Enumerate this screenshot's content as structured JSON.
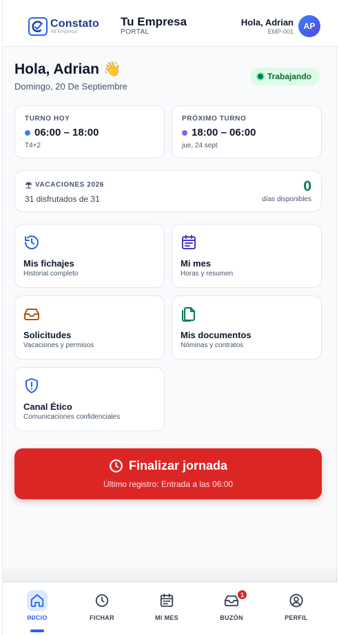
{
  "header": {
    "logo_text": "Constato",
    "logo_sub": "Mi Empresa",
    "company": "Tu Empresa",
    "portal": "PORTAL",
    "greeting": "Hola, Adrian",
    "employee_id": "EMP-001",
    "avatar_initials": "AP"
  },
  "greeting": {
    "title": "Hola, Adrian 👋",
    "date": "Domingo, 20 De Septiembre",
    "status": "Trabajando"
  },
  "shift_today": {
    "label": "TURNO HOY",
    "time": "06:00 – 18:00",
    "sub": "T4+2",
    "dot_color": "#3b82f6"
  },
  "shift_next": {
    "label": "PRÓXIMO TURNO",
    "time": "18:00 – 06:00",
    "sub": "jue, 24 sept",
    "dot_color": "#8b5cf6"
  },
  "vacations": {
    "label": "VACACIONES 2026",
    "used": "31 disfrutados de 31",
    "available_count": "0",
    "available_label": "días disponibles"
  },
  "tiles": [
    {
      "title": "Mis fichajes",
      "sub": "Historial completo",
      "icon": "history-icon",
      "color": "#2563eb"
    },
    {
      "title": "Mi mes",
      "sub": "Horas y resumen",
      "icon": "calendar-icon",
      "color": "#4338ca"
    },
    {
      "title": "Solicitudes",
      "sub": "Vacaciones y permisos",
      "icon": "inbox-icon",
      "color": "#b45309"
    },
    {
      "title": "Mis documentos",
      "sub": "Nóminas y contratos",
      "icon": "documents-icon",
      "color": "#047857"
    },
    {
      "title": "Canal Ético",
      "sub": "Comunicaciones confidenciales",
      "icon": "shield-alert-icon",
      "color": "#2563eb"
    }
  ],
  "end_shift": {
    "title": "Finalizar jornada",
    "sub": "Último registro: Entrada a las 06:00"
  },
  "nav": {
    "items": [
      {
        "label": "INICIO",
        "icon": "home-icon"
      },
      {
        "label": "FICHAR",
        "icon": "clock-icon"
      },
      {
        "label": "MI MES",
        "icon": "calendar-icon"
      },
      {
        "label": "BUZÓN",
        "icon": "inbox-icon"
      },
      {
        "label": "PERFIL",
        "icon": "user-circle-icon"
      }
    ],
    "active": "INICIO",
    "inbox_badge": "1"
  }
}
